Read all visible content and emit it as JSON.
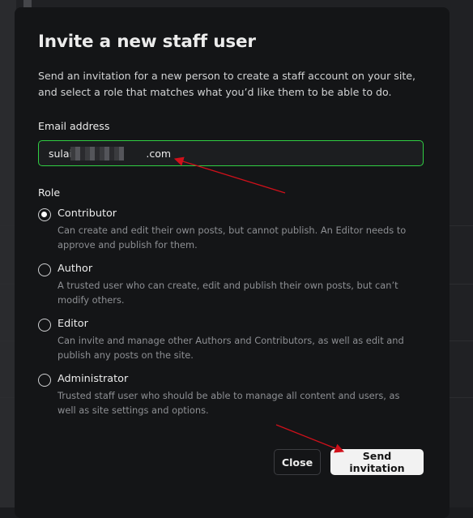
{
  "modal": {
    "title": "Invite a new staff user",
    "description": "Send an invitation for a new person to create a staff account on your site, and select a role that matches what you’d like them to be able to do."
  },
  "email": {
    "label": "Email address",
    "value": "sulai                       .com"
  },
  "role": {
    "label": "Role",
    "options": [
      {
        "title": "Contributor",
        "description": "Can create and edit their own posts, but cannot publish. An Editor needs to approve and publish for them.",
        "selected": true
      },
      {
        "title": "Author",
        "description": "A trusted user who can create, edit and publish their own posts, but can’t modify others.",
        "selected": false
      },
      {
        "title": "Editor",
        "description": "Can invite and manage other Authors and Contributors, as well as edit and publish any posts on the site.",
        "selected": false
      },
      {
        "title": "Administrator",
        "description": "Trusted staff user who should be able to manage all content and users, as well as site settings and options.",
        "selected": false
      }
    ]
  },
  "buttons": {
    "close": "Close",
    "send": "Send invitation"
  },
  "colors": {
    "input_focus_border": "#30cf43",
    "annotation_arrow": "#d0101a",
    "primary_button_bg": "#f2f2f2"
  }
}
